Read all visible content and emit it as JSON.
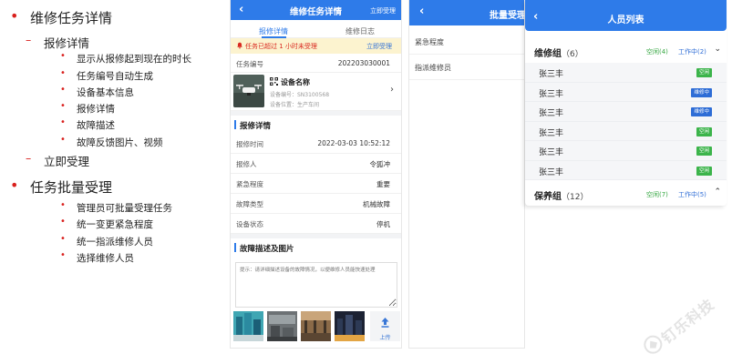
{
  "outline": {
    "items": [
      {
        "level": 1,
        "text": "维修任务详情"
      },
      {
        "level": 2,
        "text": "报修详情"
      },
      {
        "level": 3,
        "text": "显示从报修起到现在的时长"
      },
      {
        "level": 3,
        "text": "任务编号自动生成"
      },
      {
        "level": 3,
        "text": "设备基本信息"
      },
      {
        "level": 3,
        "text": "报修详情"
      },
      {
        "level": 3,
        "text": "故障描述"
      },
      {
        "level": 3,
        "text": "故障反馈图片、视频"
      },
      {
        "level": 2,
        "text": "立即受理"
      },
      {
        "level": 1,
        "text": "任务批量受理"
      },
      {
        "level": 3,
        "text": "管理员可批量受理任务"
      },
      {
        "level": 3,
        "text": "统一变更紧急程度"
      },
      {
        "level": 3,
        "text": "统一指派维修人员"
      },
      {
        "level": 3,
        "text": "选择维修人员"
      }
    ],
    "bullet_l1": "•",
    "bullet_l2": "–",
    "bullet_l3": "•"
  },
  "detail": {
    "back": "‹",
    "title": "维修任务详情",
    "action": "立即受理",
    "tabs": {
      "active": "报修详情",
      "other": "维修日志"
    },
    "warning": {
      "text": "任务已超过 1 小时未受理",
      "action": "立即受理"
    },
    "task_no_label": "任务编号",
    "task_no": "202203030001",
    "device": {
      "name": "设备名称",
      "code": "设备编号：SN3100568",
      "position": "设备位置：生产车间",
      "arrow": "›"
    },
    "section_repair": "报修详情",
    "rows": [
      {
        "k": "报修时间",
        "v": "2022-03-03 10:52:12"
      },
      {
        "k": "报修人",
        "v": "令狐冲"
      },
      {
        "k": "紧急程度",
        "v": "重要"
      },
      {
        "k": "故障类型",
        "v": "机械故障"
      },
      {
        "k": "设备状态",
        "v": "停机"
      }
    ],
    "section_fault": "故障描述及图片",
    "fault_placeholder": "提示：请详细描述设备的故障情况，以便维修人员能快速处理",
    "upload_label": "上传",
    "warn_color": "#d92a21",
    "accent": "#2e7be9"
  },
  "batch": {
    "back": "‹",
    "title": "批量受理",
    "rows": [
      "紧急程度",
      "指派维修员"
    ]
  },
  "staff": {
    "back": "‹",
    "title": "人员列表",
    "groups": [
      {
        "name": "维修组",
        "count": "（6）",
        "idle": "空闲(4)",
        "busy": "工作中(2)",
        "arrow": "⌄"
      },
      {
        "name": "保养组",
        "count": "（12）",
        "idle": "空闲(7)",
        "busy": "工作中(5)",
        "arrow": "⌃"
      }
    ],
    "members": [
      {
        "name": "张三丰",
        "status": "空闲",
        "kind": "idle"
      },
      {
        "name": "张三丰",
        "status": "维修中",
        "kind": "busy"
      },
      {
        "name": "张三丰",
        "status": "维修中",
        "kind": "busy"
      },
      {
        "name": "张三丰",
        "status": "空闲",
        "kind": "idle"
      },
      {
        "name": "张三丰",
        "status": "空闲",
        "kind": "idle"
      },
      {
        "name": "张三丰",
        "status": "空闲",
        "kind": "idle"
      }
    ],
    "idle_color": "#3cb44b",
    "busy_color": "#2e6dd6"
  },
  "watermark": "钉乐科技"
}
